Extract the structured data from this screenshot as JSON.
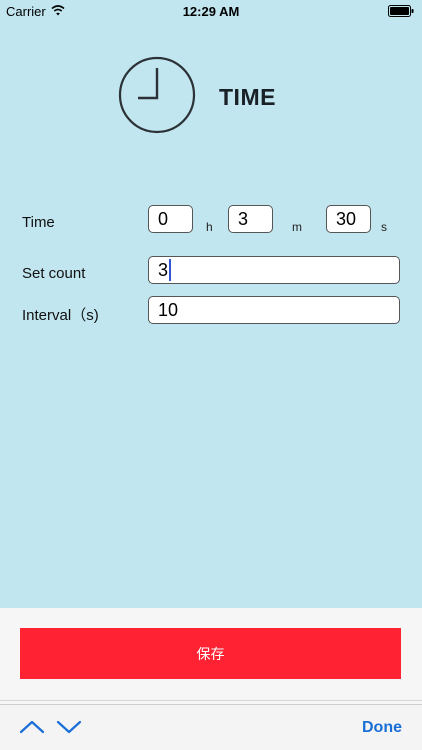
{
  "status_bar": {
    "carrier": "Carrier",
    "time": "12:29 AM"
  },
  "header": {
    "title": "TIME",
    "icon": "clock-icon"
  },
  "form": {
    "time_label": "Time",
    "hours": "0",
    "hours_unit": "h",
    "minutes": "3",
    "minutes_unit": "m",
    "seconds": "30",
    "seconds_unit": "s",
    "set_count_label": "Set count",
    "set_count": "3",
    "interval_label": "Interval（s)",
    "interval": "10"
  },
  "actions": {
    "save_label": "保存"
  },
  "keyboard_toolbar": {
    "previous_icon": "chevron-up-icon",
    "next_icon": "chevron-down-icon",
    "done_label": "Done"
  },
  "colors": {
    "background": "#c1e6ef",
    "save_button": "#ff2233",
    "accent": "#1a6fd6"
  }
}
